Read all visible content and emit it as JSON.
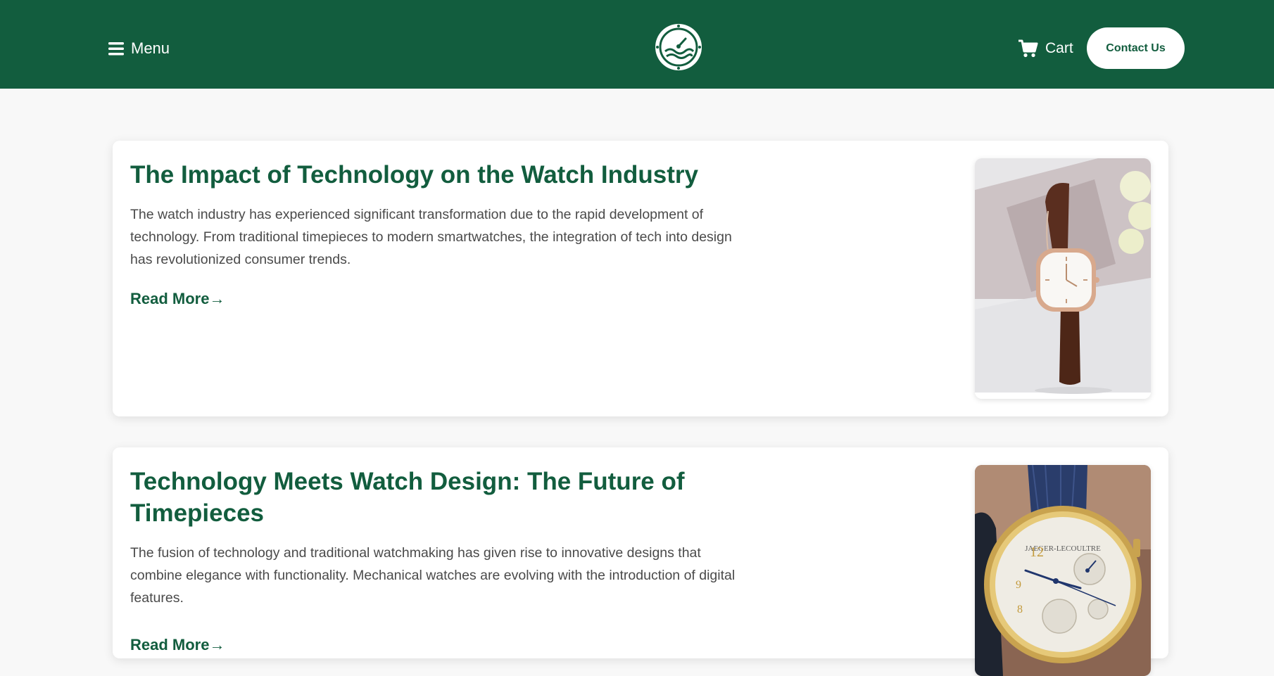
{
  "header": {
    "menu_label": "Menu",
    "cart_label": "Cart",
    "contact_label": "Contact Us",
    "brand_color": "#125d3e"
  },
  "articles": [
    {
      "title": "The Impact of Technology on the Watch Industry",
      "excerpt": "The watch industry has experienced significant transformation due to the rapid development of technology. From traditional timepieces to modern smartwatches, the integration of tech into design has revolutionized consumer trends.",
      "read_more": "Read More→",
      "image": "leather-strap-watch-photo"
    },
    {
      "title": "Technology Meets Watch Design: The Future of Timepieces",
      "excerpt": "The fusion of technology and traditional watchmaking has given rise to innovative designs that combine elegance with functionality. Mechanical watches are evolving with the introduction of digital features.",
      "read_more": "Read More→",
      "image": "gold-chronograph-watch-photo"
    }
  ]
}
